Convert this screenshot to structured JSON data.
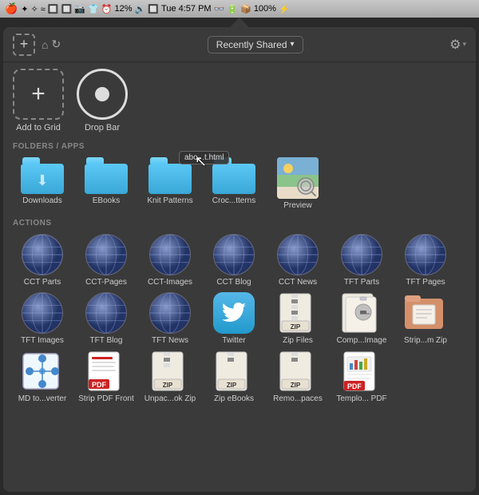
{
  "menubar": {
    "time": "Tue 4:57 PM",
    "battery": "100%",
    "wifi": "12%"
  },
  "header": {
    "add_label": "+",
    "dropdown_label": "Recently Shared",
    "gear_label": "⚙"
  },
  "top_section": {
    "add_to_grid_label": "Add to Grid",
    "drop_bar_label": "Drop Bar"
  },
  "folders_section": {
    "section_label": "FOLDERS / APPS",
    "drag_tooltip": "abo...t.html",
    "items": [
      {
        "name": "downloads-folder",
        "label": "Downloads",
        "has_download_icon": true
      },
      {
        "name": "ebooks-folder",
        "label": "EBooks",
        "has_download_icon": false
      },
      {
        "name": "knit-patterns-folder",
        "label": "Knit Patterns",
        "has_download_icon": false
      },
      {
        "name": "crochet-patterns-folder",
        "label": "Croc...tterns",
        "has_download_icon": false
      },
      {
        "name": "preview-app",
        "label": "Preview",
        "is_preview": true
      }
    ]
  },
  "actions_section": {
    "section_label": "ACTIONS",
    "items": [
      {
        "name": "cct-parts",
        "label": "CCT Parts",
        "type": "globe"
      },
      {
        "name": "cct-pages",
        "label": "CCT-Pages",
        "type": "globe"
      },
      {
        "name": "cct-images",
        "label": "CCT-Images",
        "type": "globe"
      },
      {
        "name": "cct-blog",
        "label": "CCT Blog",
        "type": "globe"
      },
      {
        "name": "cct-news",
        "label": "CCT News",
        "type": "globe"
      },
      {
        "name": "tft-parts",
        "label": "TFT Parts",
        "type": "globe"
      },
      {
        "name": "tft-pages",
        "label": "TFT Pages",
        "type": "globe"
      },
      {
        "name": "tft-images",
        "label": "TFT Images",
        "type": "globe"
      },
      {
        "name": "tft-blog",
        "label": "TFT Blog",
        "type": "globe"
      },
      {
        "name": "tft-news",
        "label": "TFT News",
        "type": "globe"
      },
      {
        "name": "twitter",
        "label": "Twitter",
        "type": "twitter"
      },
      {
        "name": "zip-files",
        "label": "Zip Files",
        "type": "zip"
      },
      {
        "name": "comp-image",
        "label": "Comp...Image",
        "type": "zip2"
      },
      {
        "name": "strip-zip",
        "label": "Strip...m Zip",
        "type": "zip3"
      },
      {
        "name": "md-converter",
        "label": "MD to...verter",
        "type": "app_blue"
      },
      {
        "name": "strip-pdf-front",
        "label": "Strip PDF Front",
        "type": "pdf"
      },
      {
        "name": "unpack-zip",
        "label": "Unpac...ok Zip",
        "type": "zip4"
      },
      {
        "name": "zip-ebooks",
        "label": "Zip eBooks",
        "type": "zip5"
      },
      {
        "name": "remove-spaces",
        "label": "Remo...paces",
        "type": "zip6"
      },
      {
        "name": "template-pdf",
        "label": "Templo... PDF",
        "type": "pdf2"
      }
    ]
  }
}
